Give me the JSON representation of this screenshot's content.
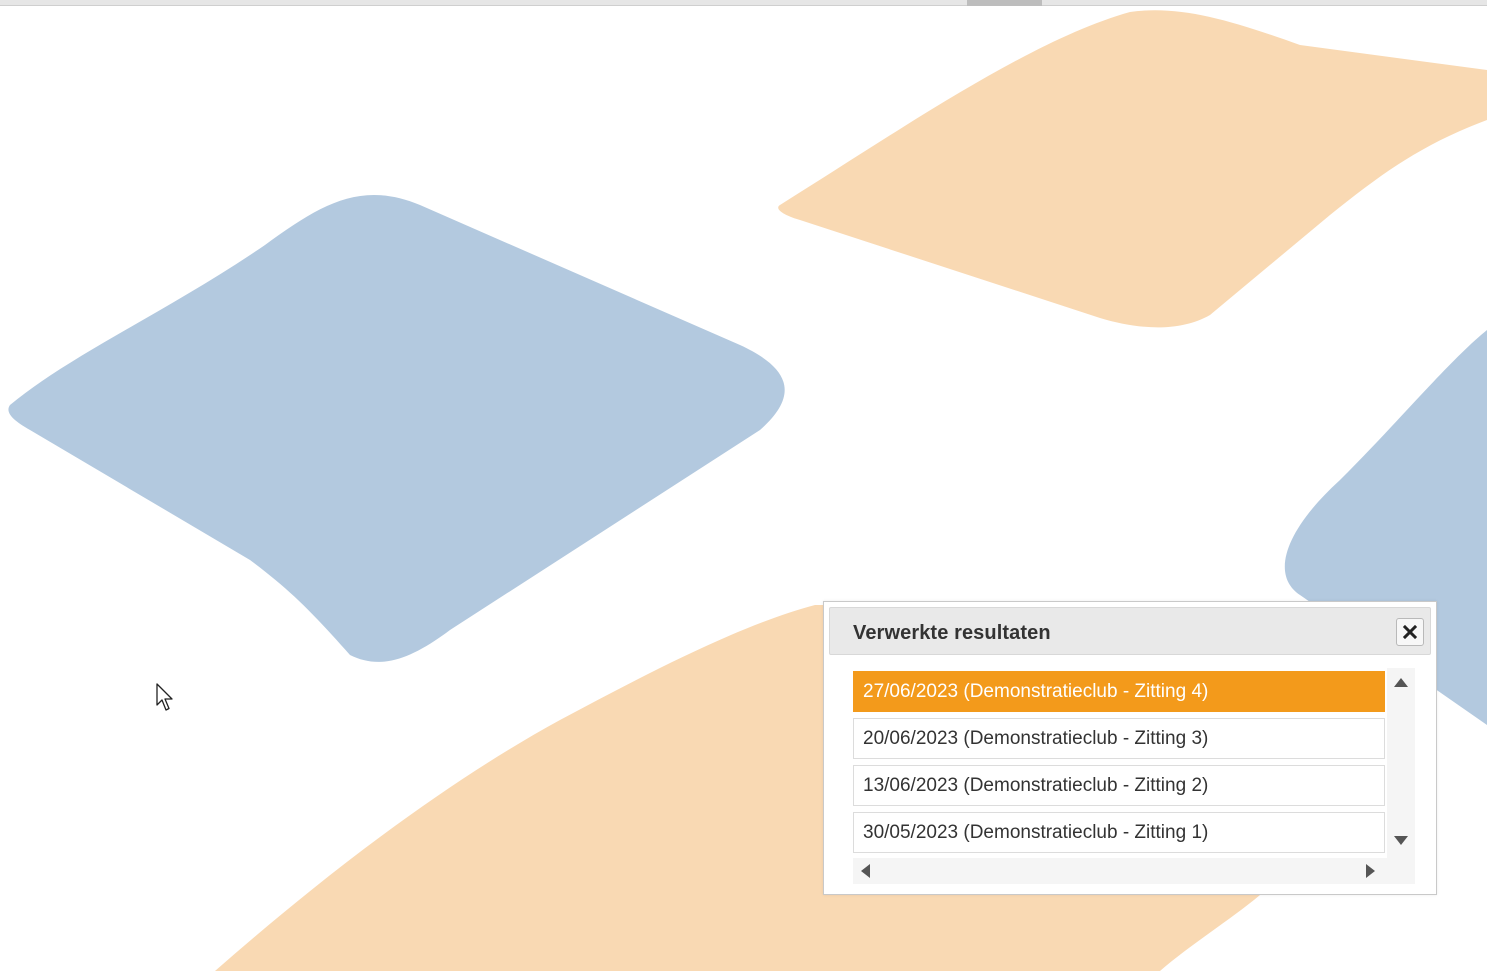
{
  "dialog": {
    "title": "Verwerkte resultaten",
    "close_icon": "close-icon",
    "selected_index": 0,
    "results": [
      {
        "label": "27/06/2023 (Demonstratieclub - Zitting 4)"
      },
      {
        "label": "20/06/2023 (Demonstratieclub - Zitting 3)"
      },
      {
        "label": "13/06/2023 (Demonstratieclub - Zitting 2)"
      },
      {
        "label": "30/05/2023 (Demonstratieclub - Zitting 1)"
      }
    ]
  },
  "colors": {
    "selected_row": "#f39a1b",
    "bg_blue": "#b3c9df",
    "bg_orange": "#f9d9b3"
  },
  "icons": {
    "cursor": "mouse-pointer-icon",
    "scroll_up": "scroll-up-icon",
    "scroll_down": "scroll-down-icon",
    "scroll_left": "scroll-left-icon",
    "scroll_right": "scroll-right-icon"
  }
}
